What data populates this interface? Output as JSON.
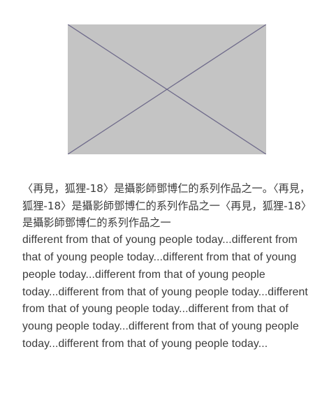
{
  "image": {
    "icon": "broken-image-placeholder-icon",
    "colors": {
      "fill": "#c4c4c4",
      "stroke": "#6f6b8b"
    }
  },
  "caption": {
    "chinese": "〈再見，狐狸-18〉是攝影師鄧博仁的系列作品之一。〈再見，狐狸-18〉是攝影師鄧博仁的系列作品之一〈再見，狐狸-18〉是攝影師鄧博仁的系列作品之一",
    "english": "different from that of young people today...different from that of young people today...different from that of young people today...different from that of young people today...different from that of young people today...different from that of young people today...different from that of young people today...different from that of young people today...different from that of young people today..."
  }
}
